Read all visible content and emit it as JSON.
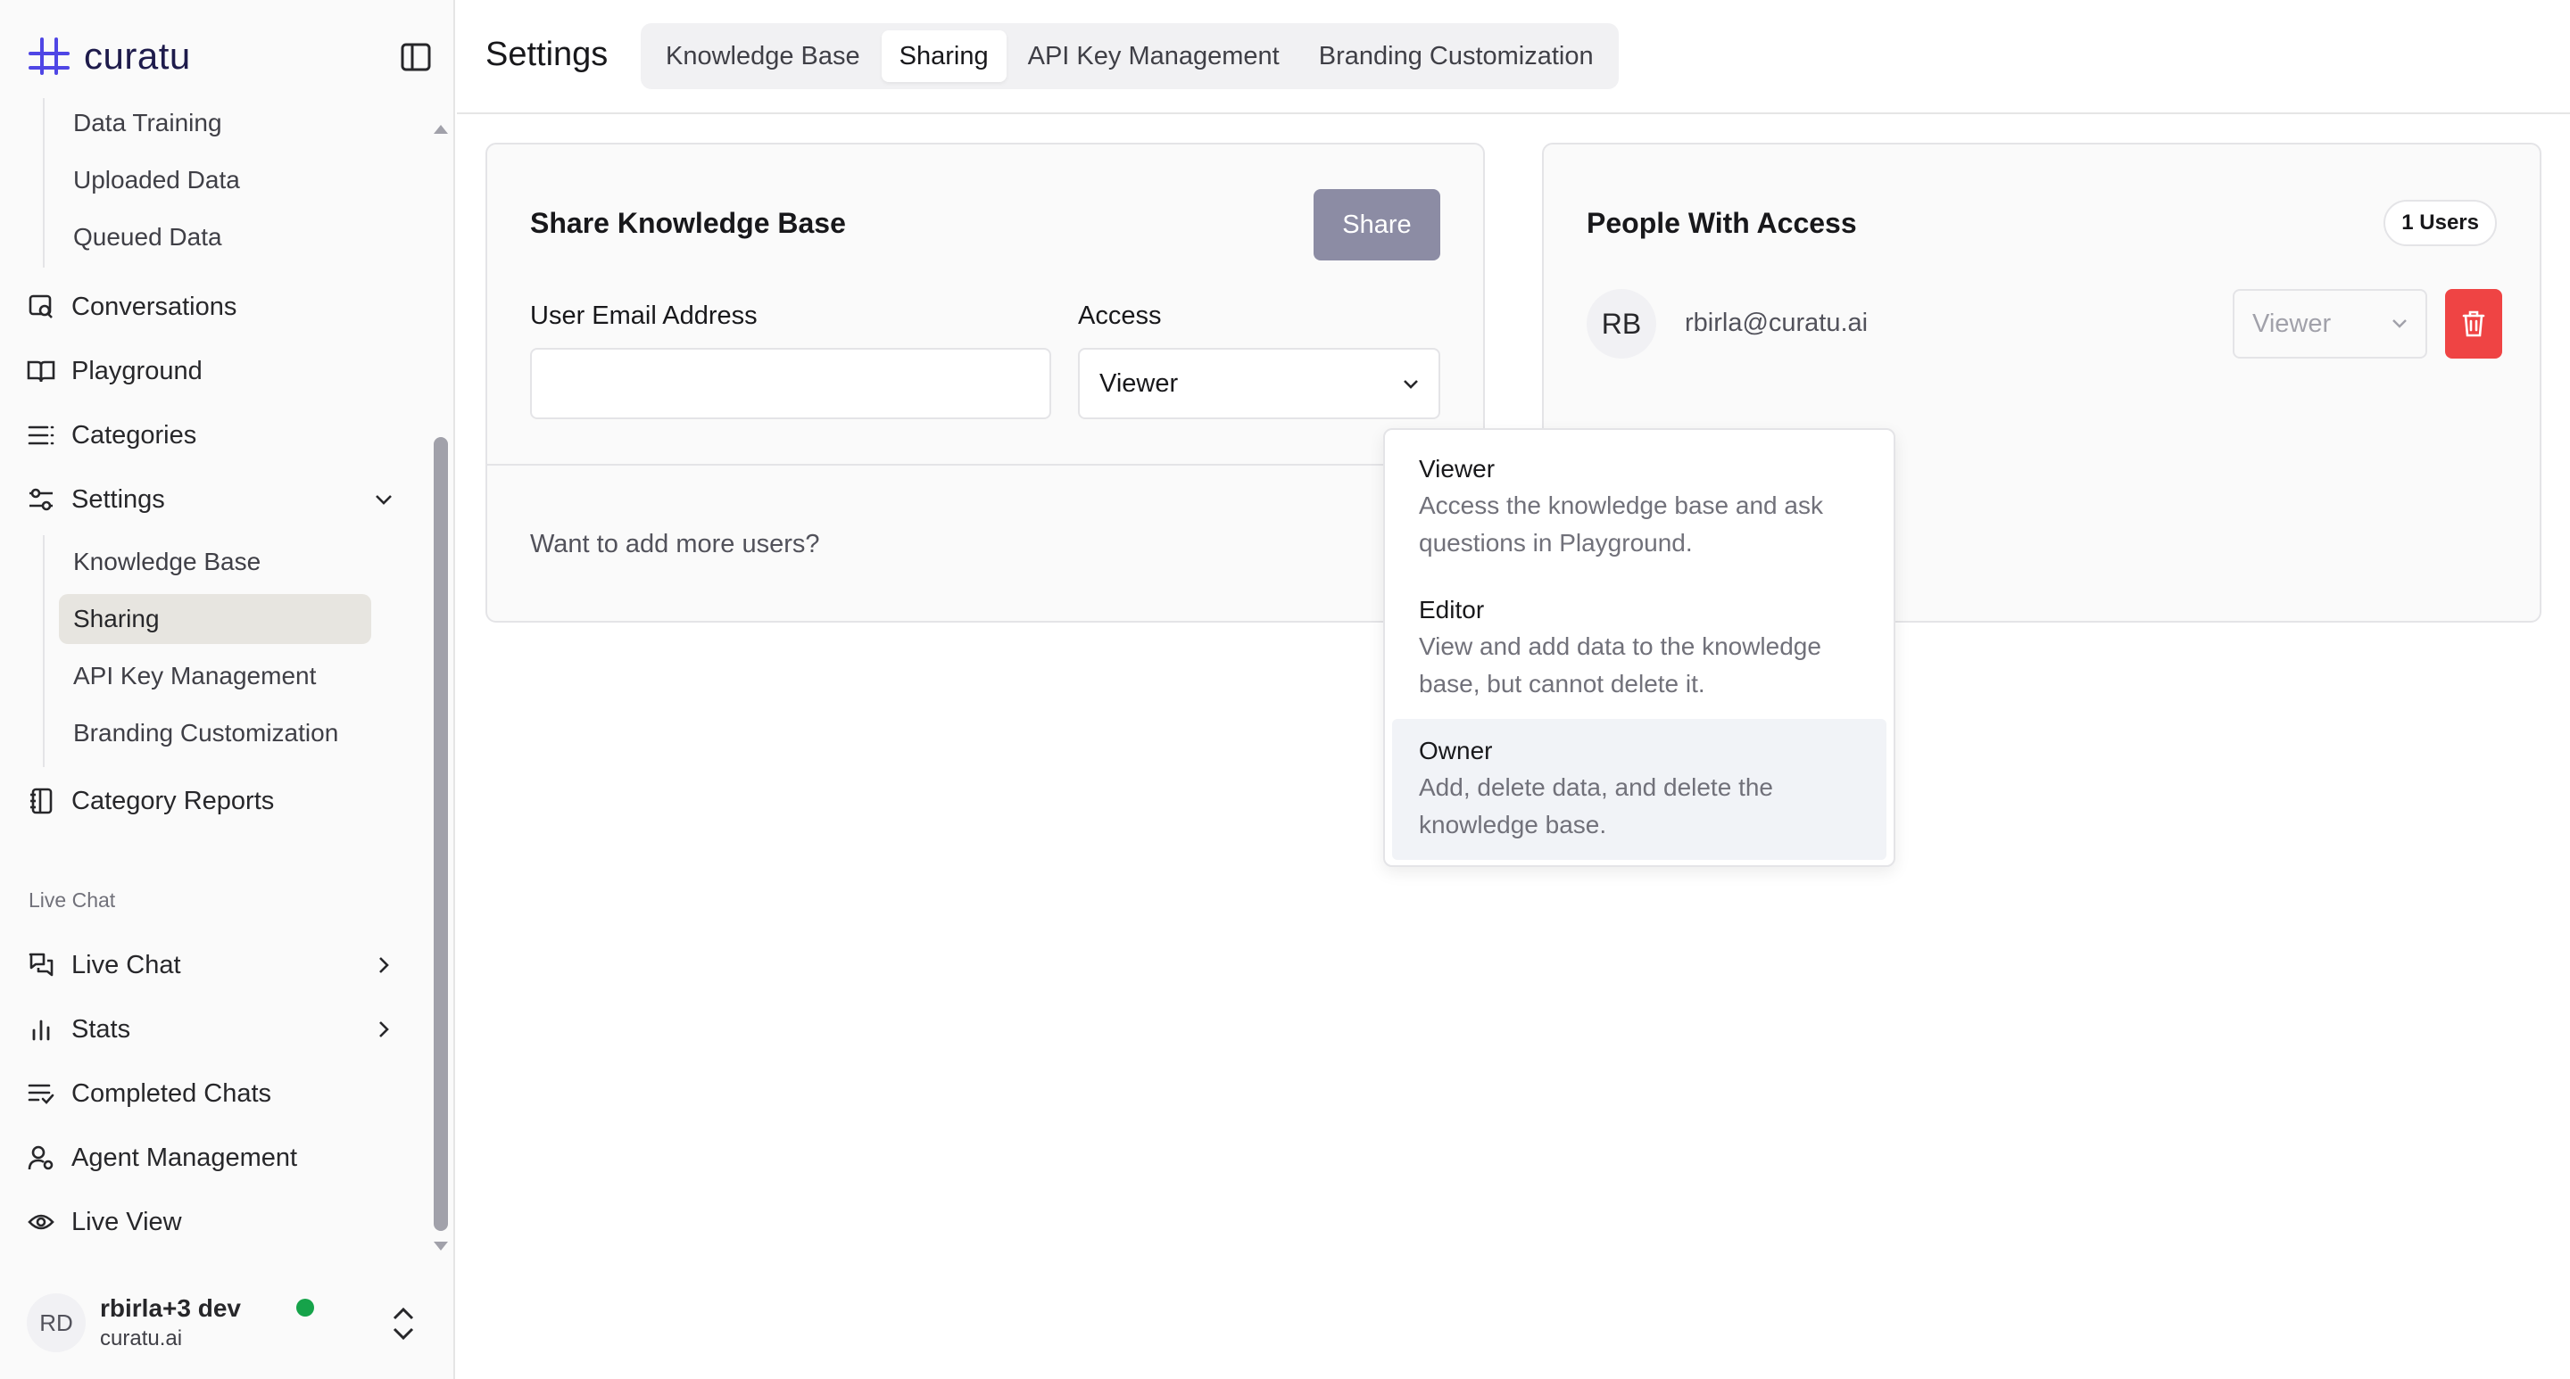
{
  "brand": {
    "name": "curatu"
  },
  "sidebar": {
    "data_children": [
      "Data Training",
      "Uploaded Data",
      "Queued Data"
    ],
    "items": {
      "conversations": "Conversations",
      "playground": "Playground",
      "categories": "Categories",
      "settings": "Settings",
      "category_reports": "Category Reports"
    },
    "settings_children": [
      "Knowledge Base",
      "Sharing",
      "API Key Management",
      "Branding Customization"
    ],
    "live_chat_section": "Live Chat",
    "live_chat_items": {
      "live_chat": "Live Chat",
      "stats": "Stats",
      "completed_chats": "Completed Chats",
      "agent_management": "Agent Management",
      "live_view": "Live View"
    },
    "user": {
      "initials": "RD",
      "name": "rbirla+3 dev",
      "org": "curatu.ai",
      "status_color": "#16a34a"
    }
  },
  "header": {
    "title": "Settings",
    "tabs": [
      "Knowledge Base",
      "Sharing",
      "API Key Management",
      "Branding Customization"
    ],
    "active_tab": "Sharing"
  },
  "share_card": {
    "title": "Share Knowledge Base",
    "share_label": "Share",
    "email_label": "User Email Address",
    "email_value": "",
    "access_label": "Access",
    "access_value": "Viewer",
    "more_users": "Want to add more users?"
  },
  "access_dropdown": {
    "options": [
      {
        "title": "Viewer",
        "desc1": "Access the knowledge base and ask",
        "desc2": "questions in Playground."
      },
      {
        "title": "Editor",
        "desc1": "View and add data to the knowledge",
        "desc2": "base, but cannot delete it."
      },
      {
        "title": "Owner",
        "desc1": "Add, delete data, and delete the",
        "desc2": "knowledge base."
      }
    ],
    "highlighted": "Owner"
  },
  "people_card": {
    "title": "People With Access",
    "count_badge": "1 Users",
    "people": [
      {
        "initials": "RB",
        "email": "rbirla@curatu.ai",
        "role": "Viewer"
      }
    ]
  },
  "colors": {
    "accent": "#1e1b4b",
    "logo": "#4f46e5",
    "share_button": "#8c8ca4",
    "danger": "#ef4444"
  }
}
